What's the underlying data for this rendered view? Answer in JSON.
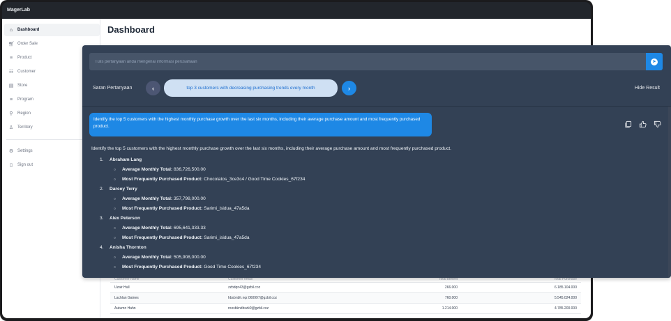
{
  "app": {
    "brand": "MagerLab"
  },
  "sidebar": {
    "items": [
      {
        "label": "Dashboard",
        "icon": "home-icon",
        "glyph": "⌂",
        "active": true
      },
      {
        "label": "Order Sale",
        "icon": "cart-icon",
        "glyph": "⚲",
        "active": false
      },
      {
        "label": "Product",
        "icon": "list-icon",
        "glyph": "≡",
        "active": false
      },
      {
        "label": "Customer",
        "icon": "users-icon",
        "glyph": "☷",
        "active": false
      },
      {
        "label": "Store",
        "icon": "store-icon",
        "glyph": "▤",
        "active": false
      },
      {
        "label": "Program",
        "icon": "program-icon",
        "glyph": "≡",
        "active": false
      },
      {
        "label": "Region",
        "icon": "map-pin-icon",
        "glyph": "⚲",
        "active": false
      },
      {
        "label": "Territory",
        "icon": "person-icon",
        "glyph": "♙",
        "active": false
      }
    ],
    "bottom_items": [
      {
        "label": "Settings",
        "icon": "gear-icon",
        "glyph": "⚙"
      },
      {
        "label": "Sign out",
        "icon": "sign-out-icon",
        "glyph": "▯"
      }
    ]
  },
  "main": {
    "title": "Dashboard",
    "table": {
      "headers": [
        "Customer name",
        "Customer email",
        "Total benefit",
        "Total Purchase"
      ],
      "rows": [
        [
          "Uzair Hull",
          "zzbdqn43@gzbil.coz",
          "266.000",
          "6.185.104.000"
        ],
        [
          "Lachlan Gaines",
          "hbsbnbh.nqr.060997@gzbil.coz",
          "760.000",
          "5.545.024.000"
        ],
        [
          "Autumn Hahn",
          "roosbkndbszk9@gzbil.coz",
          "1.214.000",
          "4.785.200.000"
        ]
      ]
    }
  },
  "assistant": {
    "placeholder": "Tulis pertanyaan anda mengenai informasi perusahaan",
    "query_value": "",
    "suggestion_label": "Saran Pertanyaan",
    "suggestion": "top 3 customers with decreasing purchasing trends every month",
    "hide_label": "Hide Result",
    "user_message": "Identify the top 5 customers with the highest monthly purchase growth over the last six months, including their average purchase amount and most frequently purchased product.",
    "answer_intro": "Identify the top 5 customers with the highest monthly purchase growth over the last six months, including their average purchase amount and most frequently purchased product.",
    "avg_label": "Average Monthly Total:",
    "prod_label": "Most Frequently Purchased Product:",
    "customers": [
      {
        "num": "1.",
        "name": "Abraham Lang",
        "avg": "836,726,500.00",
        "product": "Chocolatos_3ce3c4 / Good Time Cookies_67f234"
      },
      {
        "num": "2.",
        "name": "Darcey Terry",
        "avg": "357,798,000.00",
        "product": "Sarimi_isidua_47a5da"
      },
      {
        "num": "3.",
        "name": "Alex Peterson",
        "avg": "695,641,333.33",
        "product": "Sarimi_isidua_47a5da"
      },
      {
        "num": "4.",
        "name": "Anisha Thornton",
        "avg": "505,908,000.00",
        "product": "Good Time Cookies_67f234"
      }
    ],
    "accent_color": "#1e88e5"
  }
}
